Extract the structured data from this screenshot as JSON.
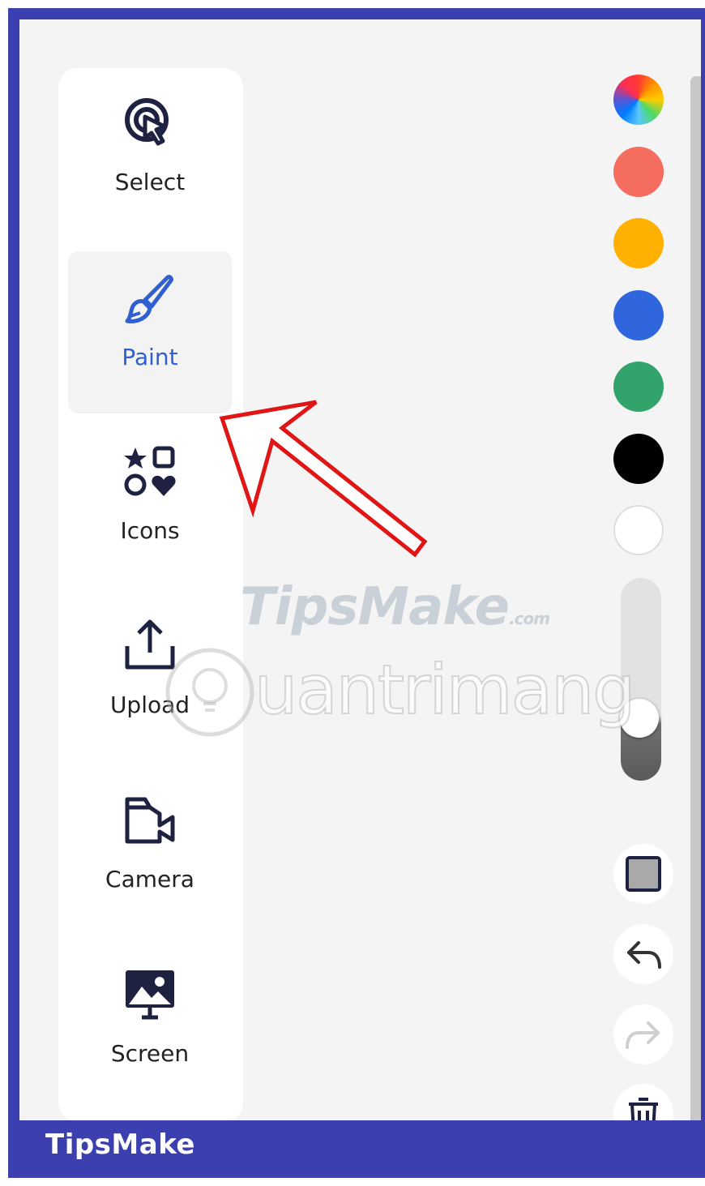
{
  "tools": [
    {
      "id": "select",
      "label": "Select",
      "icon": "select-cursor-icon"
    },
    {
      "id": "paint",
      "label": "Paint",
      "icon": "paintbrush-icon",
      "active": true
    },
    {
      "id": "icons",
      "label": "Icons",
      "icon": "shapes-icon"
    },
    {
      "id": "upload",
      "label": "Upload",
      "icon": "upload-icon"
    },
    {
      "id": "camera",
      "label": "Camera",
      "icon": "camera-icon"
    },
    {
      "id": "screen",
      "label": "Screen",
      "icon": "screen-share-icon"
    }
  ],
  "colors": {
    "palette": [
      "rainbow",
      "#f46d5e",
      "#ffb000",
      "#2f66dd",
      "#32a46b",
      "#000000",
      "#ffffff"
    ],
    "accent": "#2f5fd0",
    "frame": "#3b3fb0"
  },
  "brush_size_level": 0.72,
  "actions": [
    {
      "id": "fill",
      "icon": "fill-square-icon"
    },
    {
      "id": "undo",
      "icon": "undo-icon"
    },
    {
      "id": "redo",
      "icon": "redo-icon"
    },
    {
      "id": "delete",
      "icon": "trash-icon"
    }
  ],
  "watermark": {
    "tipsmake": "TipsMake",
    "suffix": ".com",
    "quantrimang": "uantrimang"
  },
  "brand": "TipsMake"
}
